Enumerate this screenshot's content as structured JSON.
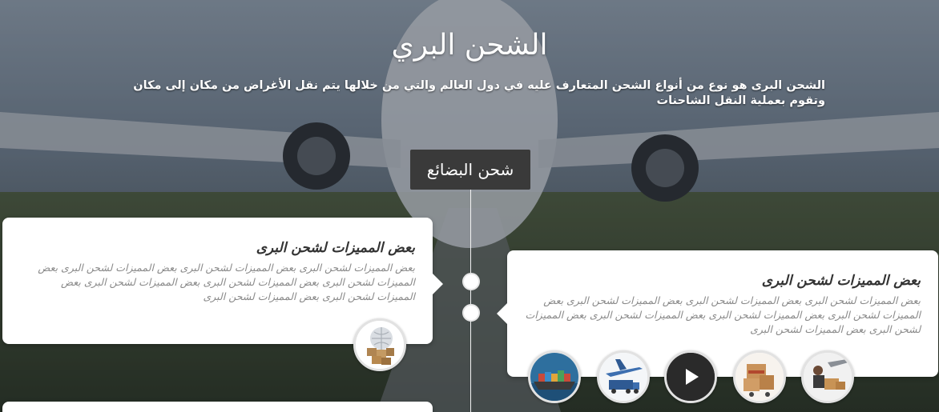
{
  "hero": {
    "title": "الشحن البري",
    "intro": "الشحن البرى هو نوع من أنواع الشحن المتعارف عليه في دول العالم والتي من خلالها يتم نقل الأغراض من مكان إلى مكان وتقوم بعملية النقل الشاحنات"
  },
  "timeline": {
    "section_label": "شحن البضائع",
    "cards": [
      {
        "title": "بعض المميزات لشحن البرى",
        "text": "بعض المميزات لشحن البرى بعض المميزات لشحن البرى بعض المميزات لشحن البرى بعض المميزات لشحن البرى بعض المميزات لشحن البرى بعض المميزات لشحن البرى بعض المميزات لشحن البرى بعض المميزات لشحن البرى"
      },
      {
        "title": "بعض المميزات لشحن البرى",
        "text": "بعض المميزات لشحن البرى بعض المميزات لشحن البرى بعض المميزات لشحن البرى بعض المميزات لشحن البرى بعض المميزات لشحن البرى بعض المميزات لشحن البرى بعض المميزات لشحن البرى بعض المميزات لشحن البرى"
      }
    ]
  },
  "icons": {
    "globe": "globe-boxes-icon",
    "ship": "cargo-ship-icon",
    "plane": "cargo-plane-icon",
    "play": "play-icon",
    "boxes": "express-delivery-boxes-icon",
    "delivery": "delivery-truck-icon"
  },
  "colors": {
    "card_bg": "#ffffff",
    "tag_bg": "#3a3a3a",
    "title_text": "#333333",
    "body_text": "#8a8a8a"
  }
}
